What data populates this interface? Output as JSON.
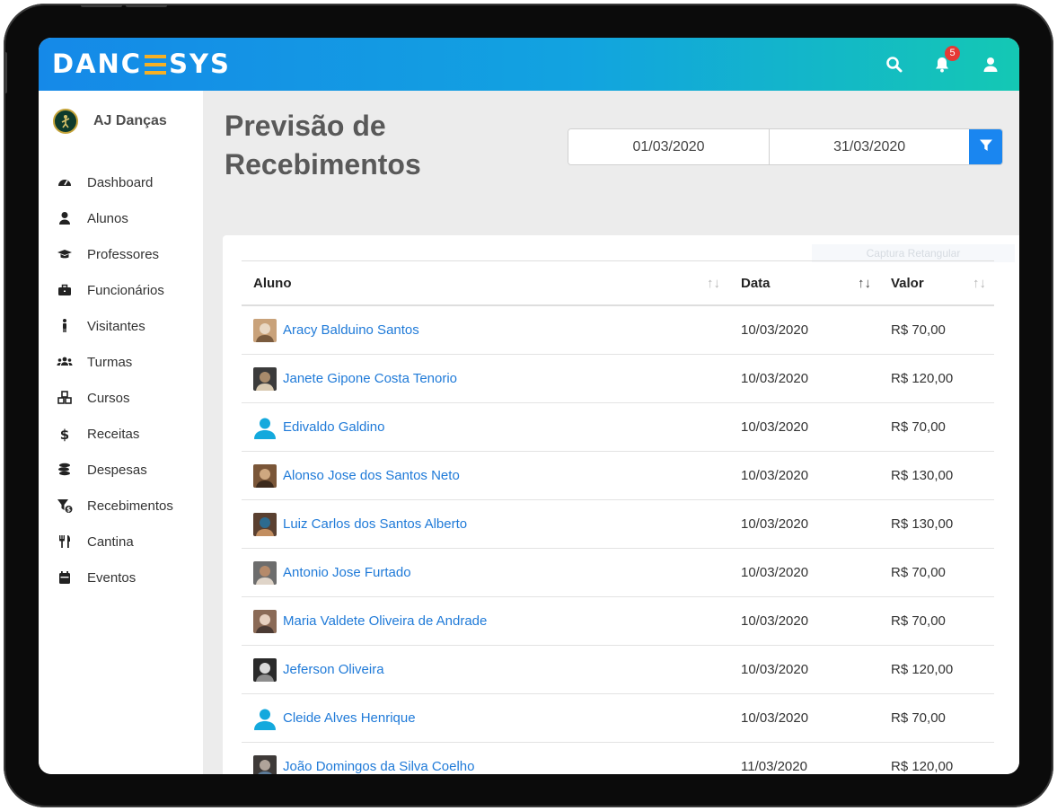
{
  "header": {
    "logo_text_left": "DANC",
    "logo_text_right": "SYS",
    "notification_count": "5"
  },
  "sidebar": {
    "school_name": "AJ Danças",
    "items": [
      {
        "label": "Dashboard",
        "icon": "speedometer-icon"
      },
      {
        "label": "Alunos",
        "icon": "user-icon"
      },
      {
        "label": "Professores",
        "icon": "graduation-cap-icon"
      },
      {
        "label": "Funcionários",
        "icon": "briefcase-icon"
      },
      {
        "label": "Visitantes",
        "icon": "person-standing-icon"
      },
      {
        "label": "Turmas",
        "icon": "users-group-icon"
      },
      {
        "label": "Cursos",
        "icon": "cubes-icon"
      },
      {
        "label": "Receitas",
        "icon": "dollar-icon"
      },
      {
        "label": "Despesas",
        "icon": "coins-icon"
      },
      {
        "label": "Recebimentos",
        "icon": "filter-dollar-icon"
      },
      {
        "label": "Cantina",
        "icon": "cutlery-icon"
      },
      {
        "label": "Eventos",
        "icon": "calendar-icon"
      }
    ]
  },
  "main": {
    "title": "Previsão de Recebimentos",
    "date_from": "01/03/2020",
    "date_to": "31/03/2020",
    "ghost_label": "Captura Retangular"
  },
  "table": {
    "columns": [
      "Aluno",
      "Data",
      "Valor"
    ],
    "rows": [
      {
        "aluno": "Aracy Balduino Santos",
        "data": "10/03/2020",
        "valor": "R$ 70,00",
        "photo": true
      },
      {
        "aluno": "Janete Gipone Costa Tenorio",
        "data": "10/03/2020",
        "valor": "R$ 120,00",
        "photo": true
      },
      {
        "aluno": "Edivaldo Galdino",
        "data": "10/03/2020",
        "valor": "R$ 70,00",
        "photo": false
      },
      {
        "aluno": "Alonso Jose dos Santos Neto",
        "data": "10/03/2020",
        "valor": "R$ 130,00",
        "photo": true
      },
      {
        "aluno": "Luiz Carlos dos Santos Alberto",
        "data": "10/03/2020",
        "valor": "R$ 130,00",
        "photo": true
      },
      {
        "aluno": "Antonio Jose Furtado",
        "data": "10/03/2020",
        "valor": "R$ 70,00",
        "photo": true
      },
      {
        "aluno": "Maria Valdete Oliveira de Andrade",
        "data": "10/03/2020",
        "valor": "R$ 70,00",
        "photo": true
      },
      {
        "aluno": "Jeferson Oliveira",
        "data": "10/03/2020",
        "valor": "R$ 120,00",
        "photo": true
      },
      {
        "aluno": "Cleide Alves Henrique",
        "data": "10/03/2020",
        "valor": "R$ 70,00",
        "photo": false
      },
      {
        "aluno": "João Domingos da Silva Coelho",
        "data": "11/03/2020",
        "valor": "R$ 120,00",
        "photo": true
      }
    ]
  },
  "colors": {
    "header_start": "#1589e8",
    "header_end": "#14c8b4",
    "link": "#1f7ad8",
    "filter_button": "#1a86f0",
    "badge": "#e53935",
    "logo_accent": "#f5b025"
  }
}
